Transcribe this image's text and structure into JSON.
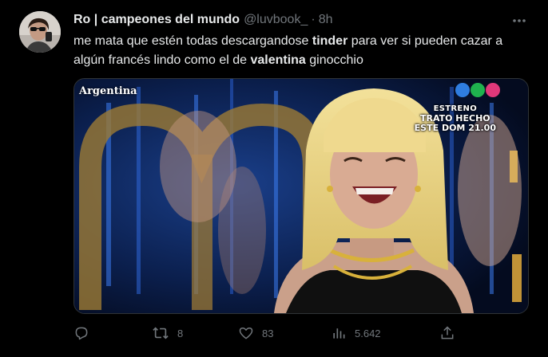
{
  "tweet": {
    "display_name": "Ro | campeones del mundo",
    "handle": "@luvbook_",
    "separator": "·",
    "time": "8h",
    "text": {
      "p1": "me mata que estén todas descargandose ",
      "b1": "tinder",
      "p2": " para ver si pueden cazar a algún francés lindo como el de ",
      "b2": "valentina",
      "p3": " ginocchio"
    },
    "media": {
      "channel_label": "Argentina",
      "promo_line1": "ESTRENO",
      "promo_line2": "TRATO HECHO",
      "promo_line3": "ESTE DOM 21.00"
    },
    "actions": {
      "reply": {
        "icon": "reply-icon",
        "count": ""
      },
      "retweet": {
        "icon": "retweet-icon",
        "count": "8"
      },
      "like": {
        "icon": "heart-icon",
        "count": "83"
      },
      "views": {
        "icon": "views-icon",
        "count": "5.642"
      },
      "share": {
        "icon": "share-icon",
        "count": ""
      }
    }
  },
  "colors": {
    "background": "#000000",
    "text_primary": "#e7e9ea",
    "text_secondary": "#71767b",
    "border": "#2f3336"
  }
}
